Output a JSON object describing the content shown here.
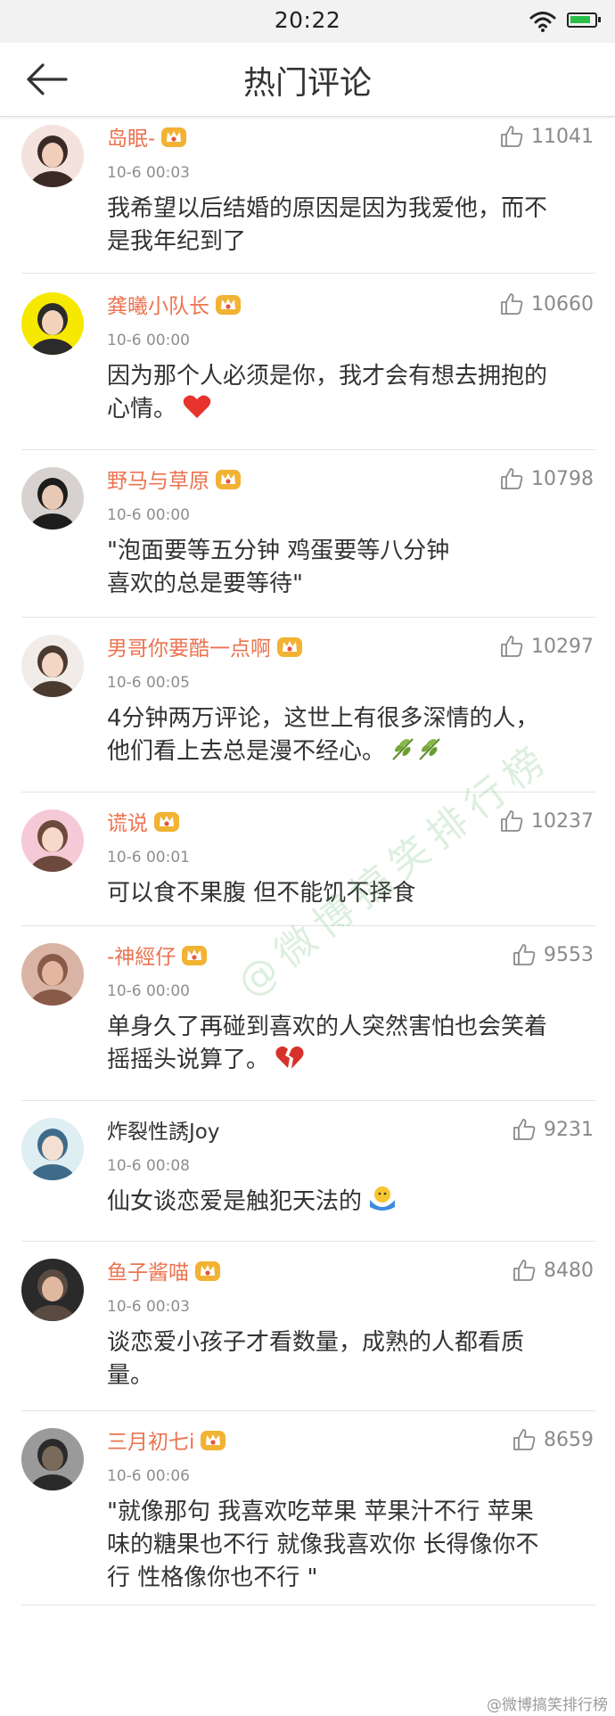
{
  "status_bar": {
    "time": "20:22"
  },
  "header": {
    "title": "热门评论"
  },
  "comments": [
    {
      "username": "岛眠-",
      "vip": true,
      "likes": "11041",
      "timestamp": "10-6 00:03",
      "lines": [
        "我希望以后结婚的原因是因为我爱他，而不",
        "是我年纪到了"
      ]
    },
    {
      "username": "龚曦小队长",
      "vip": true,
      "likes": "10660",
      "timestamp": "10-6 00:00",
      "lines": [
        "因为那个人必须是你，我才会有想去拥抱的",
        "心情。"
      ],
      "emoji": "red-heart"
    },
    {
      "username": "野马与草原",
      "vip": true,
      "likes": "10798",
      "timestamp": "10-6 00:00",
      "lines": [
        "\"泡面要等五分钟  鸡蛋要等八分钟",
        "喜欢的总是要等待\""
      ]
    },
    {
      "username": "男哥你要酷一点啊",
      "vip": true,
      "likes": "10297",
      "timestamp": "10-6 00:05",
      "lines": [
        "4分钟两万评论，这世上有很多深情的人，",
        "他们看上去总是漫不经心。"
      ],
      "emoji": "leaves"
    },
    {
      "username": "谎说",
      "vip": true,
      "likes": "10237",
      "timestamp": "10-6 00:01",
      "lines": [
        "可以食不果腹 但不能饥不择食"
      ]
    },
    {
      "username": "-神經仔",
      "vip": true,
      "likes": "9553",
      "timestamp": "10-6 00:00",
      "lines": [
        "单身久了再碰到喜欢的人突然害怕也会笑着",
        "摇摇头说算了。"
      ],
      "emoji": "broken-heart"
    },
    {
      "username": "炸裂性誘Joy",
      "vip": false,
      "likes": "9231",
      "timestamp": "10-6 00:08",
      "lines": [
        "仙女谈恋爱是触犯天法的"
      ],
      "emoji": "shrug-emoji"
    },
    {
      "username": "鱼子酱喵",
      "vip": true,
      "likes": "8480",
      "timestamp": "10-6 00:03",
      "lines": [
        "谈恋爱小孩子才看数量，成熟的人都看质",
        "量。"
      ]
    },
    {
      "username": "三月初七i",
      "vip": true,
      "likes": "8659",
      "timestamp": "10-6 00:06",
      "lines": [
        "\"就像那句 我喜欢吃苹果 苹果汁不行 苹果",
        "味的糖果也不行 就像我喜欢你 长得像你不",
        "行 性格像你也不行 \""
      ]
    }
  ],
  "watermark": "@微博搞笑排行榜",
  "footer": "@微博搞笑排行榜",
  "colors": {
    "username": "#eb7350",
    "accent_green": "#2bbf4a",
    "vip_gold": "#f2b233"
  },
  "icons": {
    "back": "back-arrow-icon",
    "like": "thumbs-up-icon",
    "vip": "vip-crown-icon",
    "wifi": "wifi-icon",
    "battery": "battery-icon"
  }
}
